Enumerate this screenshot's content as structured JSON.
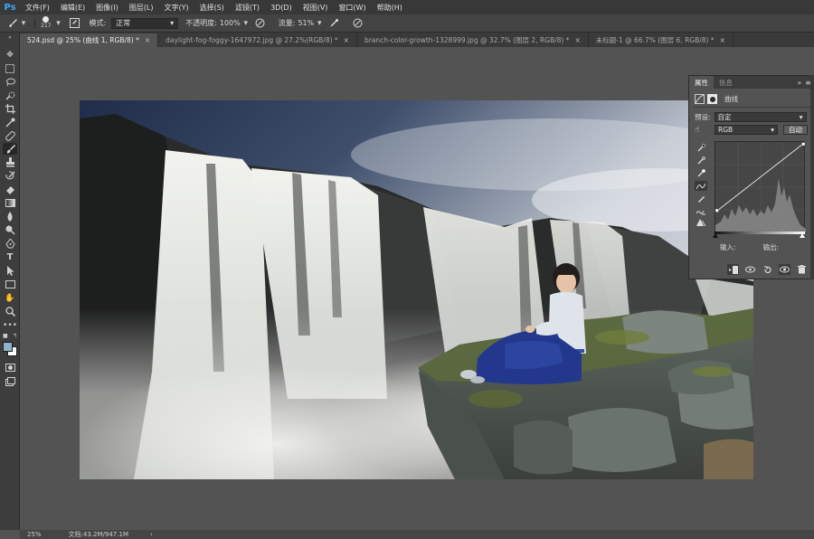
{
  "app": {
    "logo": "Ps"
  },
  "menu": [
    "文件(F)",
    "编辑(E)",
    "图像(I)",
    "图层(L)",
    "文字(Y)",
    "选择(S)",
    "滤镜(T)",
    "3D(D)",
    "视图(V)",
    "窗口(W)",
    "帮助(H)"
  ],
  "options": {
    "brush_size": "217",
    "mode_label": "模式:",
    "mode_value": "正常",
    "opacity_label": "不透明度:",
    "opacity_value": "100%",
    "flow_label": "流量:",
    "flow_value": "51%"
  },
  "tabs": [
    {
      "label": "524.psd @ 25% (曲线 1, RGB/8) *",
      "active": true
    },
    {
      "label": "daylight-fog-foggy-1647972.jpg @ 27.2%(RGB/8) *",
      "active": false
    },
    {
      "label": "branch-color-growth-1328999.jpg @ 32.7% (图层 2, RGB/8) *",
      "active": false
    },
    {
      "label": "未标题-1 @ 66.7% (图层 6, RGB/8) *",
      "active": false
    }
  ],
  "tab_close_glyph": "×",
  "status": {
    "zoom": "25%",
    "doc": "文档:43.2M/947.1M"
  },
  "properties": {
    "tab_properties": "属性",
    "tab_info": "信息",
    "layer_type": "曲线",
    "preset_label": "预设:",
    "preset_value": "自定",
    "channel_value": "RGB",
    "auto_button": "自动",
    "input_label": "输入:",
    "output_label": "输出:"
  },
  "colors": {
    "accent": "#3fa9f5",
    "foreground_swatch": "#8fb3c6",
    "background_swatch": "#ffffff"
  }
}
